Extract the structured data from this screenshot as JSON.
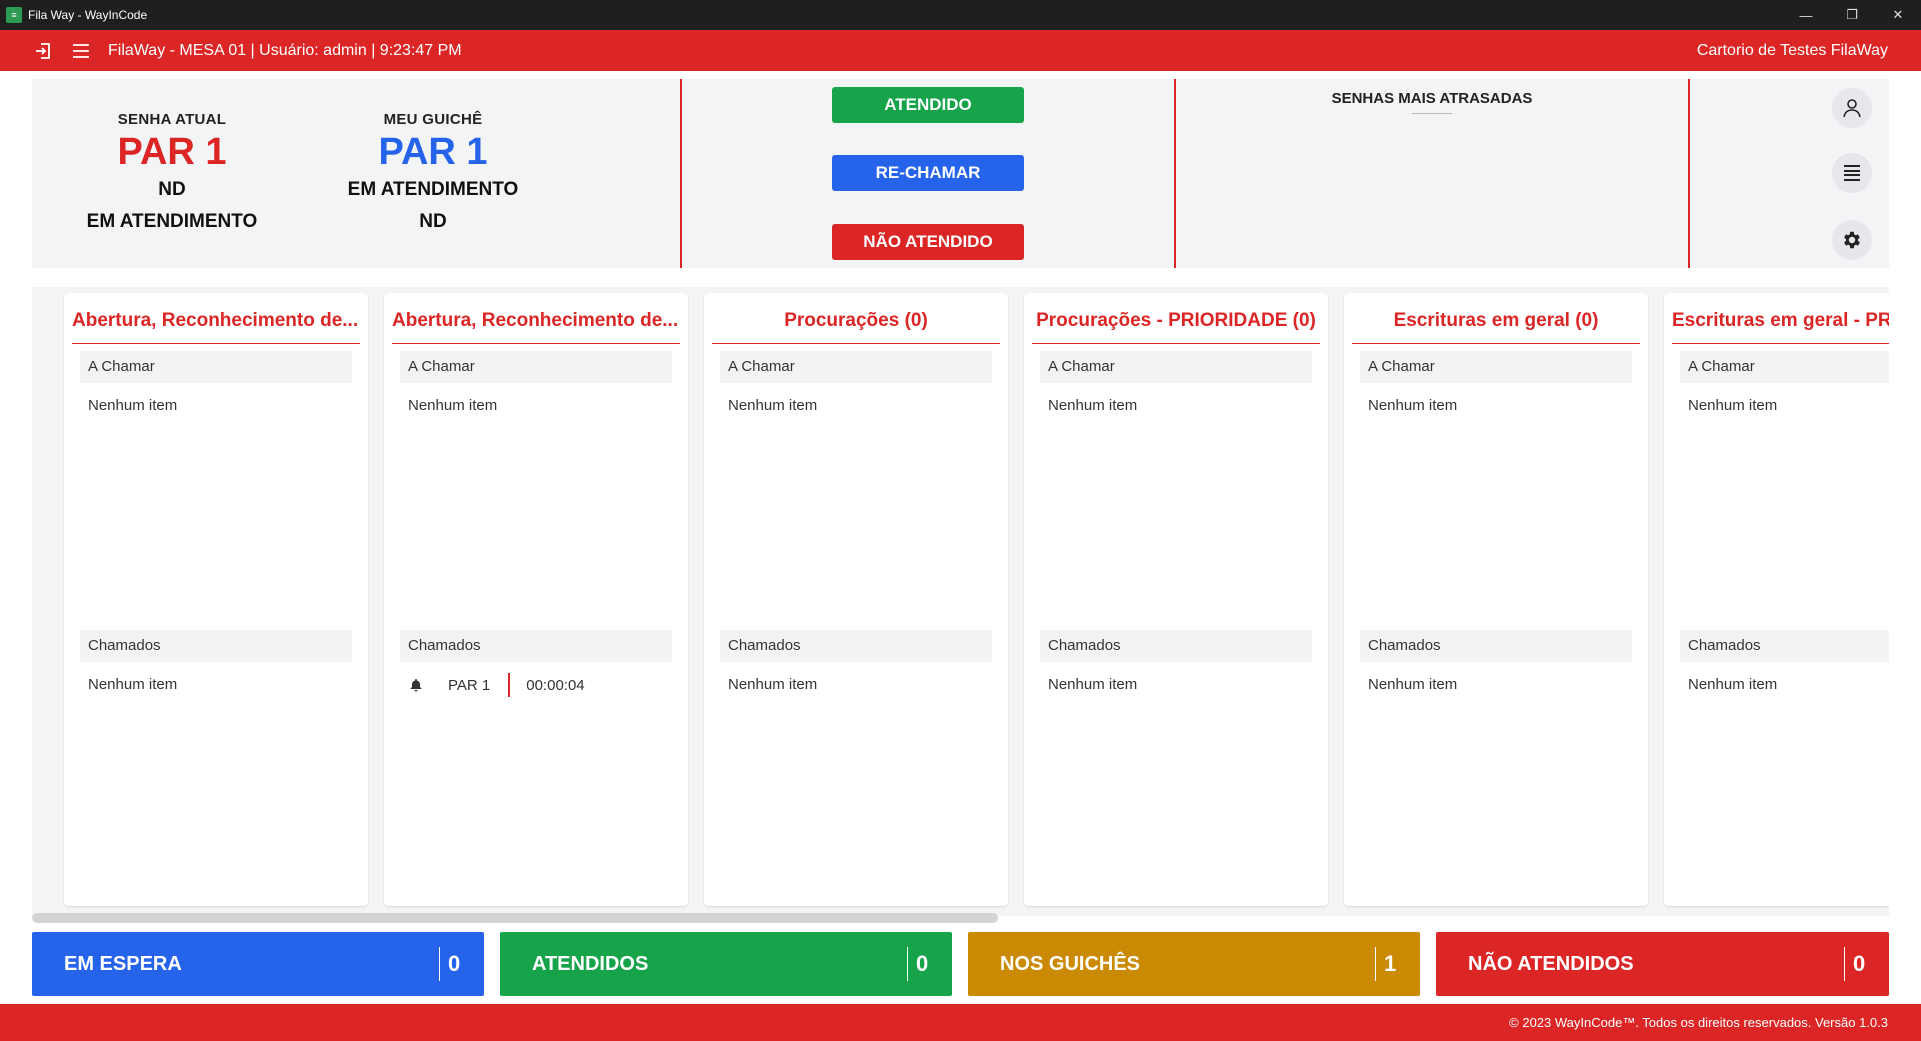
{
  "window": {
    "title": "Fila Way - WayInCode",
    "app_icon": "filaway-app-icon"
  },
  "appbar": {
    "info": "FilaWay - MESA 01 | Usuário: admin | 9:23:47 PM",
    "org": "Cartorio de Testes FilaWay"
  },
  "senha_atual": {
    "label": "SENHA ATUAL",
    "code": "PAR 1",
    "line1": "ND",
    "line2": "EM ATENDIMENTO"
  },
  "meu_guiche": {
    "label": "MEU GUICHÊ",
    "code": "PAR 1",
    "line1": "EM ATENDIMENTO",
    "line2": "ND"
  },
  "actions": {
    "atendido": "ATENDIDO",
    "rechamar": "RE-CHAMAR",
    "nao_atendido": "NÃO ATENDIDO"
  },
  "atrasadas": {
    "title": "SENHAS MAIS ATRASADAS"
  },
  "lanes": [
    {
      "title": "Abertura, Reconhecimento de...",
      "a_chamar": "A Chamar",
      "a_empty": "Nenhum item",
      "chamados": "Chamados",
      "c_empty": "Nenhum item"
    },
    {
      "title": "Abertura, Reconhecimento de...",
      "a_chamar": "A Chamar",
      "a_empty": "Nenhum item",
      "chamados": "Chamados",
      "called_code": "PAR 1",
      "called_time": "00:00:04"
    },
    {
      "title": "Procurações (0)",
      "a_chamar": "A Chamar",
      "a_empty": "Nenhum item",
      "chamados": "Chamados",
      "c_empty": "Nenhum item"
    },
    {
      "title": "Procurações - PRIORIDADE (0)",
      "a_chamar": "A Chamar",
      "a_empty": "Nenhum item",
      "chamados": "Chamados",
      "c_empty": "Nenhum item"
    },
    {
      "title": "Escrituras em geral (0)",
      "a_chamar": "A Chamar",
      "a_empty": "Nenhum item",
      "chamados": "Chamados",
      "c_empty": "Nenhum item"
    },
    {
      "title": "Escrituras em geral - PR",
      "a_chamar": "A Chamar",
      "a_empty": "Nenhum item",
      "chamados": "Chamados",
      "c_empty": "Nenhum item"
    }
  ],
  "stats": [
    {
      "name": "EM ESPERA",
      "value": "0",
      "color": "#2563eb"
    },
    {
      "name": "ATENDIDOS",
      "value": "0",
      "color": "#16a34a"
    },
    {
      "name": "NOS GUICHÊS",
      "value": "1",
      "color": "#ca8a04"
    },
    {
      "name": "NÃO ATENDIDOS",
      "value": "0",
      "color": "#dc2626"
    }
  ],
  "footer": {
    "text": "© 2023 WayInCode™. Todos os direitos reservados. Versão 1.0.3"
  },
  "colors": {
    "brand_red": "#dc2626",
    "blue": "#2563eb",
    "green": "#16a34a",
    "amber": "#ca8a04"
  }
}
